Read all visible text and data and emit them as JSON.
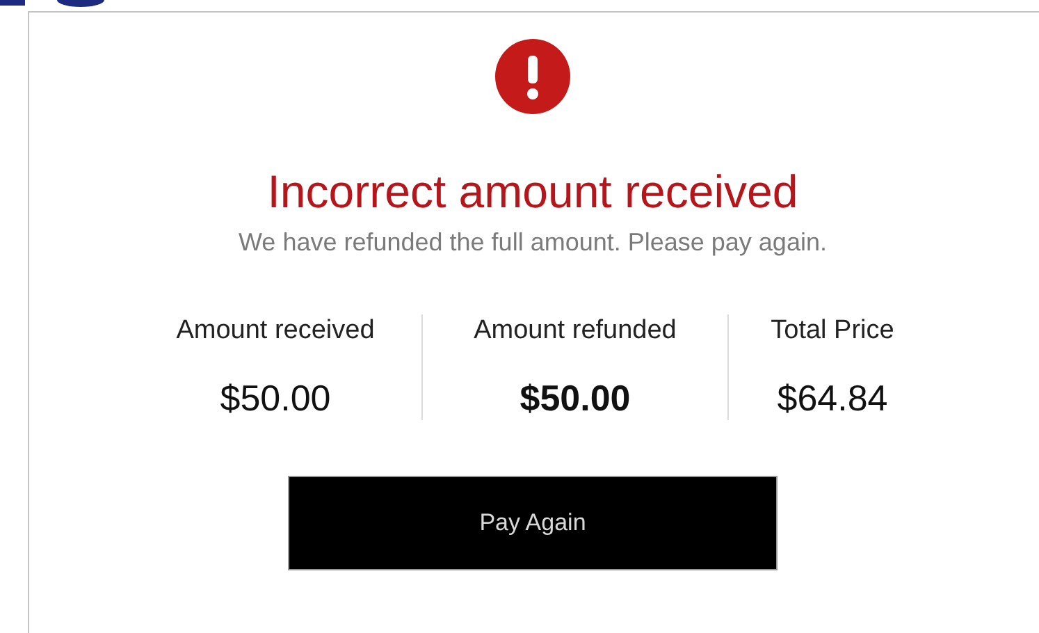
{
  "alert": {
    "title": "Incorrect amount received",
    "message": "We have refunded the full amount. Please pay again."
  },
  "amounts": [
    {
      "label": "Amount received",
      "value": "$50.00",
      "emphasized": false
    },
    {
      "label": "Amount refunded",
      "value": "$50.00",
      "emphasized": true
    },
    {
      "label": "Total Price",
      "value": "$64.84",
      "emphasized": false
    }
  ],
  "button": {
    "label": "Pay Again"
  }
}
